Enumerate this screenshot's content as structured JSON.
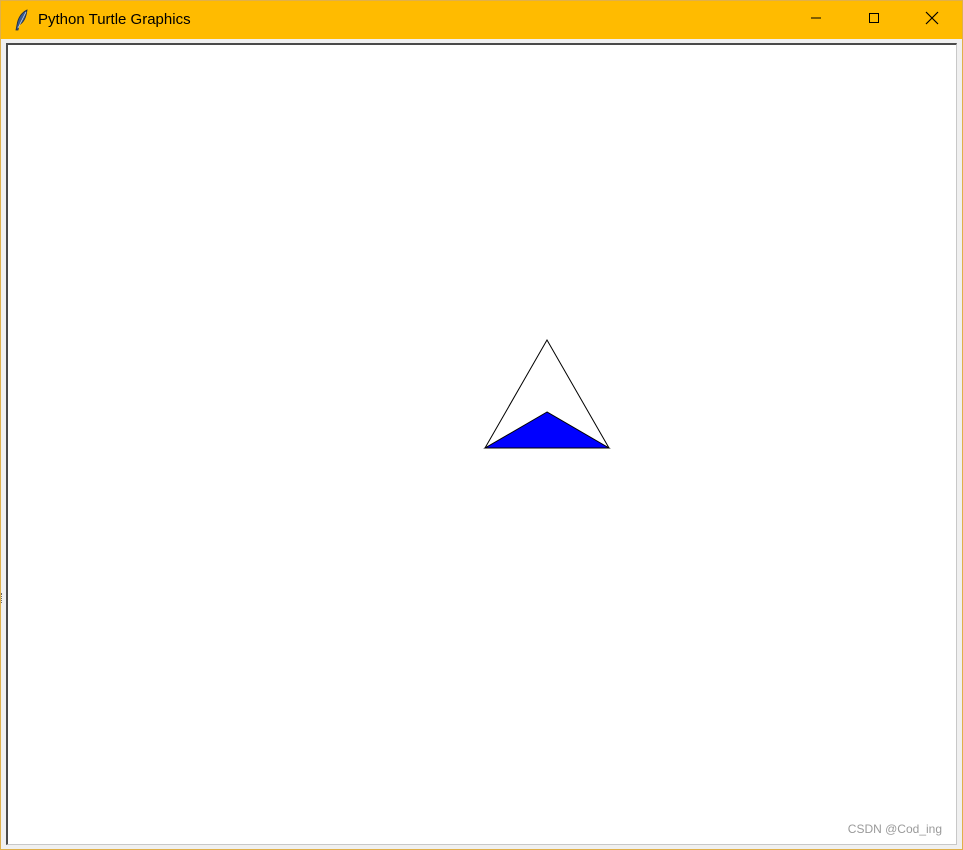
{
  "window": {
    "title": "Python Turtle Graphics",
    "titlebar_color": "#ffbb00",
    "icons": {
      "app": "feather-icon",
      "minimize": "minimize-icon",
      "maximize": "maximize-icon",
      "close": "close-icon"
    }
  },
  "canvas": {
    "background": "#ffffff",
    "shapes": [
      {
        "name": "outline-triangle",
        "stroke": "#000000",
        "fill": "none"
      },
      {
        "name": "filled-triangle",
        "stroke": "#000000",
        "fill": "#0000ff"
      }
    ]
  },
  "watermark": "CSDN @Cod_ing"
}
